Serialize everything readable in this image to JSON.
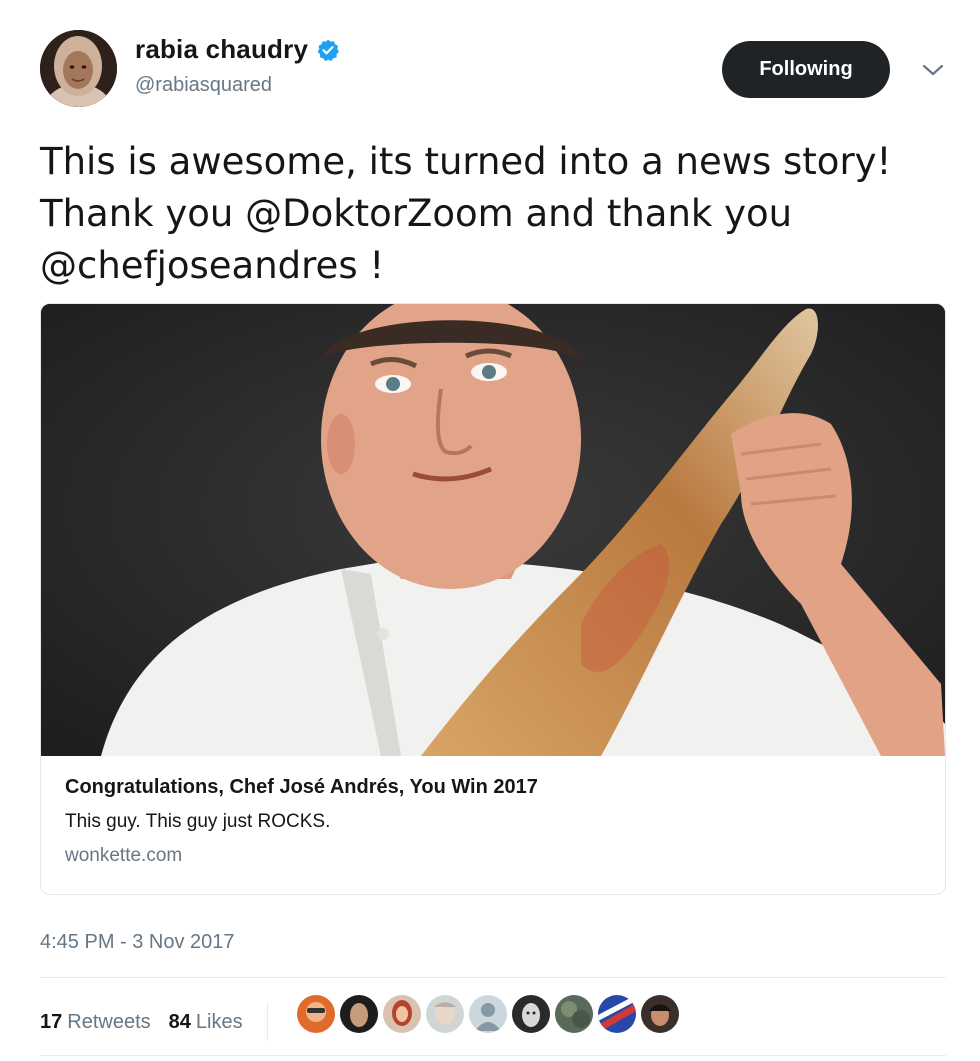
{
  "author": {
    "display_name": "rabia chaudry",
    "handle": "@rabiasquared",
    "verified_icon": "verified-badge-icon"
  },
  "actions": {
    "follow_label": "Following",
    "menu_icon": "chevron-down-icon"
  },
  "tweet": {
    "text_lines": [
      "This is awesome, its turned into a news story!",
      "Thank you @DoktorZoom and thank you",
      "@chefjoseandres !"
    ]
  },
  "card": {
    "title": "Congratulations, Chef José Andrés, You Win 2017",
    "description": "This guy. This guy just ROCKS.",
    "domain": "wonkette.com"
  },
  "timestamp": "4:45 PM - 3 Nov 2017",
  "stats": {
    "retweets_count": "17",
    "retweets_label": "Retweets",
    "likes_count": "84",
    "likes_label": "Likes"
  },
  "colors": {
    "follow_button_bg": "#1f2326",
    "verified_blue": "#1da1f2",
    "muted_text": "#657786",
    "border": "#e1e8ed"
  }
}
